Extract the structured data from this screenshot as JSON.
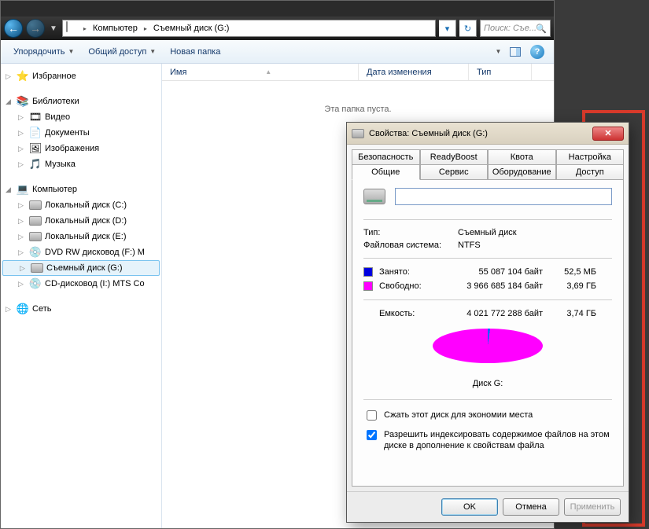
{
  "address": {
    "root": "Компьютер",
    "current": "Съемный диск (G:)"
  },
  "search": {
    "placeholder": "Поиск: Съе..."
  },
  "toolbar": {
    "organize": "Упорядочить",
    "share": "Общий доступ",
    "newfolder": "Новая папка"
  },
  "columns": {
    "name": "Имя",
    "modified": "Дата изменения",
    "type": "Тип"
  },
  "empty_msg": "Эта папка пуста.",
  "sidebar": {
    "favorites": "Избранное",
    "libraries": "Библиотеки",
    "lib_items": [
      "Видео",
      "Документы",
      "Изображения",
      "Музыка"
    ],
    "computer": "Компьютер",
    "drives": [
      "Локальный диск (C:)",
      "Локальный диск (D:)",
      "Локальный диск (E:)",
      "DVD RW дисковод (F:) M",
      "Съемный диск (G:)",
      "CD-дисковод (I:) MTS Co"
    ],
    "network": "Сеть"
  },
  "dialog": {
    "title": "Свойства: Съемный диск (G:)",
    "tabs_row1": [
      "Безопасность",
      "ReadyBoost",
      "Квота",
      "Настройка"
    ],
    "tabs_row2": [
      "Общие",
      "Сервис",
      "Оборудование",
      "Доступ"
    ],
    "name_value": "",
    "type_label": "Тип:",
    "type_value": "Съемный диск",
    "fs_label": "Файловая система:",
    "fs_value": "NTFS",
    "used_label": "Занято:",
    "used_bytes": "55 087 104 байт",
    "used_human": "52,5 МБ",
    "free_label": "Свободно:",
    "free_bytes": "3 966 685 184 байт",
    "free_human": "3,69 ГБ",
    "cap_label": "Емкость:",
    "cap_bytes": "4 021 772 288 байт",
    "cap_human": "3,74 ГБ",
    "pie_caption": "Диск G:",
    "chk_compress": "Сжать этот диск для экономии места",
    "chk_index": "Разрешить индексировать содержимое файлов на этом диске в дополнение к свойствам файла",
    "btn_ok": "OK",
    "btn_cancel": "Отмена",
    "btn_apply": "Применить"
  },
  "chart_data": {
    "type": "pie",
    "title": "Диск G:",
    "series": [
      {
        "name": "Занято",
        "value": 55087104,
        "human": "52,5 МБ",
        "color": "#0000e0"
      },
      {
        "name": "Свободно",
        "value": 3966685184,
        "human": "3,69 ГБ",
        "color": "#ff00ff"
      }
    ],
    "total": {
      "name": "Емкость",
      "value": 4021772288,
      "human": "3,74 ГБ"
    }
  }
}
